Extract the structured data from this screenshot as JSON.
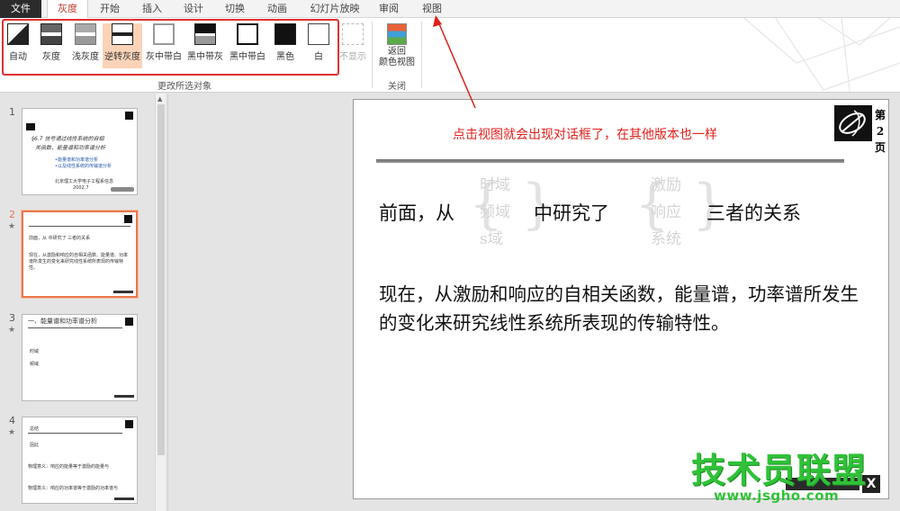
{
  "tabs": [
    {
      "label": "文件",
      "id": "file"
    },
    {
      "label": "灰度",
      "id": "grayscale"
    },
    {
      "label": "开始",
      "id": "home"
    },
    {
      "label": "插入",
      "id": "insert"
    },
    {
      "label": "设计",
      "id": "design"
    },
    {
      "label": "切换",
      "id": "transitions"
    },
    {
      "label": "动画",
      "id": "animations"
    },
    {
      "label": "幻灯片放映",
      "id": "slideshow"
    },
    {
      "label": "审阅",
      "id": "review"
    },
    {
      "label": "视图",
      "id": "view"
    }
  ],
  "ribbon": {
    "buttons": [
      {
        "label": "自动",
        "icon": "auto-icon"
      },
      {
        "label": "灰度",
        "icon": "grayscale-icon"
      },
      {
        "label": "浅灰度",
        "icon": "light-grayscale-icon"
      },
      {
        "label": "逆转灰度",
        "icon": "inverse-grayscale-icon",
        "selected": true
      },
      {
        "label": "灰中带白",
        "icon": "gray-with-white-fill-icon"
      },
      {
        "label": "黑中带灰",
        "icon": "black-with-grayscale-fill-icon"
      },
      {
        "label": "黑中带白",
        "icon": "black-with-white-fill-icon"
      },
      {
        "label": "黑色",
        "icon": "black-icon"
      },
      {
        "label": "白",
        "icon": "white-icon"
      },
      {
        "label": "不显示",
        "icon": "dont-show-icon",
        "disabled": true
      }
    ],
    "group1_label": "更改所选对象",
    "back_line1": "返回",
    "back_line2": "颜色视图",
    "group2_label": "关闭"
  },
  "slide_panel": {
    "slides": [
      {
        "number": "1",
        "star": "",
        "title_lines": [
          "§6.7 信号通过线性系统的自相",
          "关函数、能量谱和功率谱分析"
        ],
        "bullets": [
          "•能量谱和功率谱分析",
          "•以及线性系统的传输谱分析"
        ],
        "footer": "北京理工大学电子工程系信息",
        "date": "2002.7"
      },
      {
        "number": "2",
        "star": "★",
        "text": "前面，从    中研究了    三者的关系",
        "para": "现在，从激励和响应的自相关函数、能量谱、功率谱所发生的变化来研究线性系统所表现的传输特性。"
      },
      {
        "number": "3",
        "star": "★",
        "title": "一、能量谱和功率谱分析",
        "rows": [
          "时域",
          "频域"
        ]
      },
      {
        "number": "4",
        "star": "★",
        "rows": [
          "总结",
          "因此",
          "物理意义：响应的能量等于激励的能量与",
          "物理意义：响应的功率谱等于激励的功率谱与"
        ]
      }
    ]
  },
  "slide": {
    "annotation": "点击视图就会出现对话框了，在其他版本也一样",
    "page_mark": [
      "第",
      "2",
      "页"
    ],
    "line1_a": "前面，从",
    "ghost_left": [
      "时域",
      "频域",
      "s域"
    ],
    "line1_b": "中研究了",
    "ghost_right": [
      "激励",
      "响应",
      "系统"
    ],
    "line1_c": "三者的关系",
    "paragraph": "现在，从激励和响应的自相关函数，能量谱，功率谱所发生的变化来研究线性系统所表现的传输特性。",
    "footer_x": "X"
  },
  "watermark": {
    "cn": "技术员联盟",
    "url": "www.jsgho.com"
  },
  "colors": {
    "annotation_red": "#e0201a",
    "selected_tab": "#c0392b",
    "selected_button_bg": "#fbd3b8",
    "current_slide_border": "#e9774b",
    "watermark_green": "#2fc237"
  }
}
